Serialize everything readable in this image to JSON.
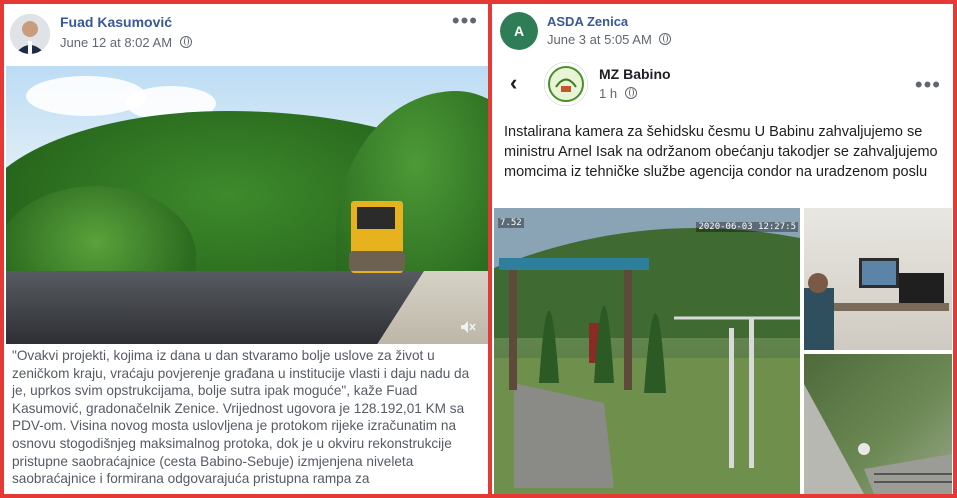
{
  "left_post": {
    "author": "Fuad Kasumović",
    "timestamp": "June 12 at 8:02 AM",
    "more_icon": "more-dots-icon",
    "text": "\"Ovakvi projekti, kojima iz dana u dan stvaramo bolje uslove za život u zeničkom kraju, vraćaju povjerenje građana u institucije vlasti i daju nadu da je, uprkos svim opstrukcijama, bolje sutra ipak moguće\", kaže Fuad Kasumović, gradonačelnik Zenice. Vrijednost ugovora je 128.192,01 KM sa PDV-om. Visina novog mosta uslovljena je protokom rijeke izračunatim na osnovu stogodišnjeg maksimalnog protoka, dok je u okviru rekonstrukcije pristupne saobraćajnice (cesta Babino-Sebuje) izmjenjena niveleta saobraćajnice i formirana odgovarajuća pristupna rampa za"
  },
  "right_post": {
    "author": "ASDA Zenica",
    "timestamp": "June 3 at 5:05 AM",
    "shared_page": "MZ Babino",
    "shared_time": "1 h",
    "text": "Instalirana kamera  za šehidsku česmu  U Babinu zahvaljujemo  se ministru Arnel Isak na  održanom obećanju takodjer se zahvaljujemo momcima iz tehničke službe agencija condor na uradzenom poslu",
    "camera_stamp_left": "7.52",
    "camera_stamp_right": "2020-06-03 12:27:5"
  },
  "colors": {
    "frame": "#e53935",
    "author_blue": "#385898"
  }
}
